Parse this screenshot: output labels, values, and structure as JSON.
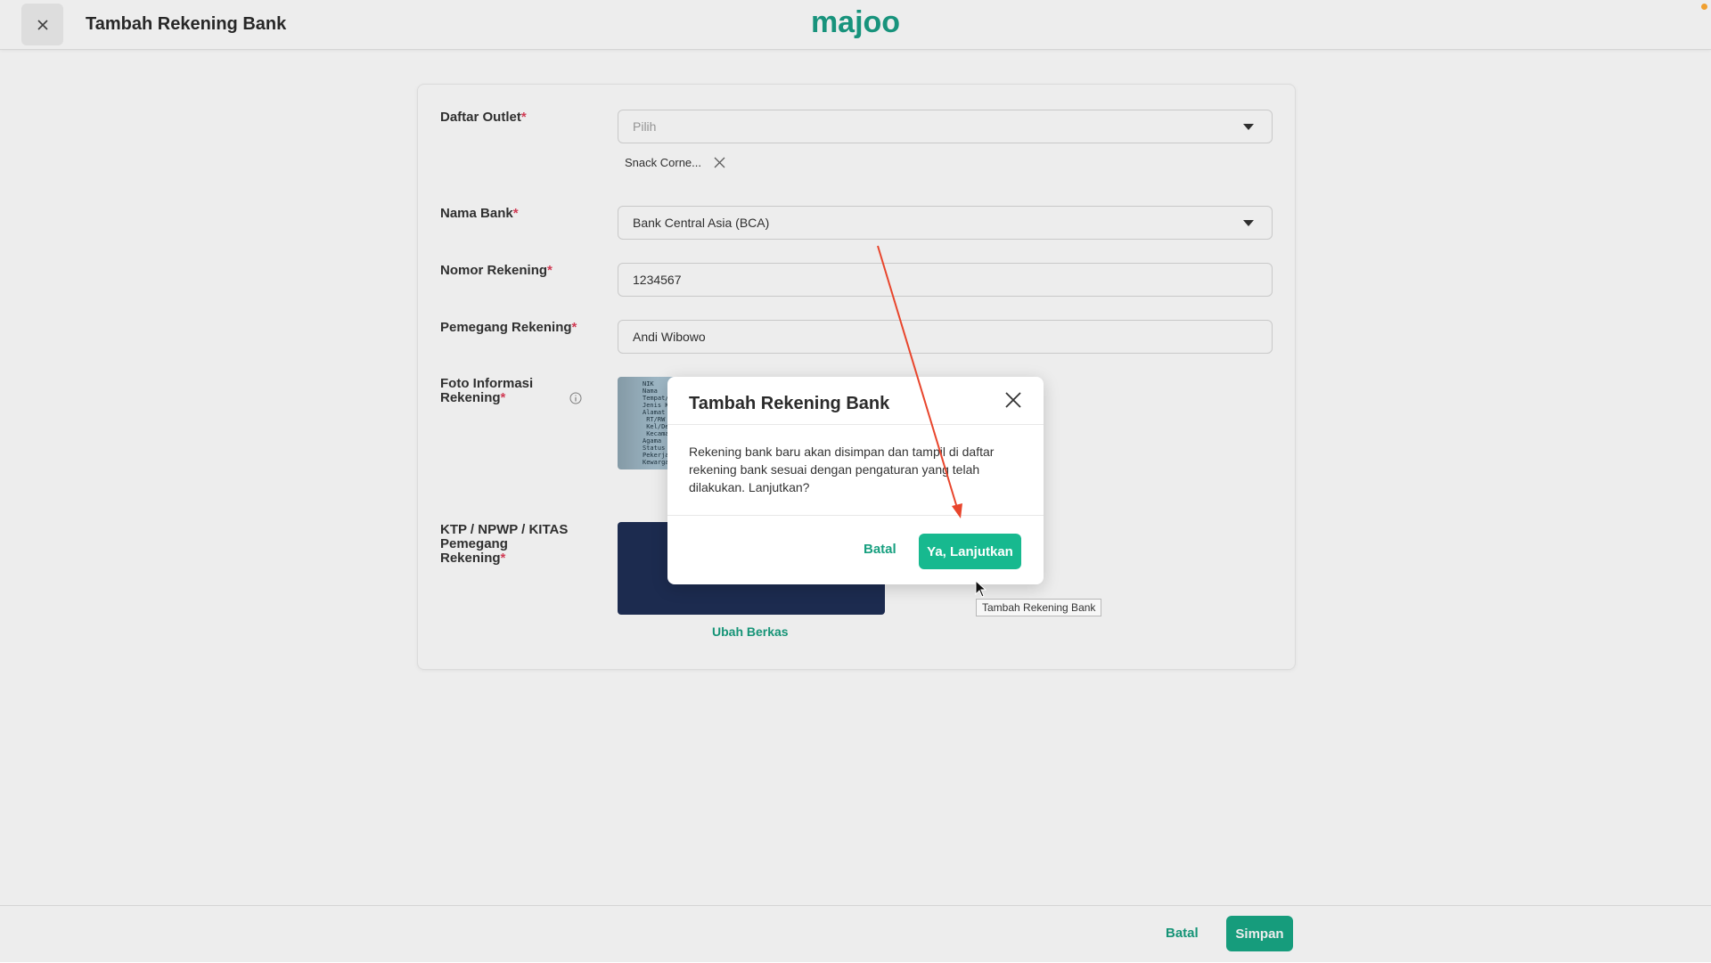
{
  "header": {
    "title": "Tambah Rekening Bank",
    "logo_text": "majoo",
    "close_icon": "close-icon"
  },
  "form": {
    "outlet": {
      "label": "Daftar Outlet",
      "required": "*",
      "placeholder": "Pilih",
      "chip": "Snack Corne..."
    },
    "bank": {
      "label": "Nama Bank",
      "required": "*",
      "value": "Bank Central Asia (BCA)"
    },
    "account_number": {
      "label": "Nomor Rekening",
      "required": "*",
      "value": "1234567"
    },
    "holder": {
      "label": "Pemegang Rekening",
      "required": "*",
      "value": "Andi Wibowo"
    },
    "photo": {
      "label_line1": "Foto Informasi",
      "label_line2": "Rekening",
      "required": "*"
    },
    "ktp": {
      "label_line1": "KTP / NPWP / KITAS",
      "label_line2": "Pemegang",
      "label_line3": "Rekening",
      "required": "*",
      "change_link": "Ubah Berkas"
    }
  },
  "footer": {
    "cancel": "Batal",
    "save": "Simpan"
  },
  "modal": {
    "title": "Tambah Rekening Bank",
    "body": "Rekening bank baru akan disimpan dan tampil di daftar rekening bank sesuai dengan pengaturan yang telah dilakukan. Lanjutkan?",
    "cancel": "Batal",
    "confirm": "Ya, Lanjutkan"
  },
  "tooltip": "Tambah Rekening Bank",
  "colors": {
    "brand": "#18a886",
    "confirm": "#17b98f",
    "required": "#e0405b",
    "annotation_arrow": "#e8452c"
  }
}
